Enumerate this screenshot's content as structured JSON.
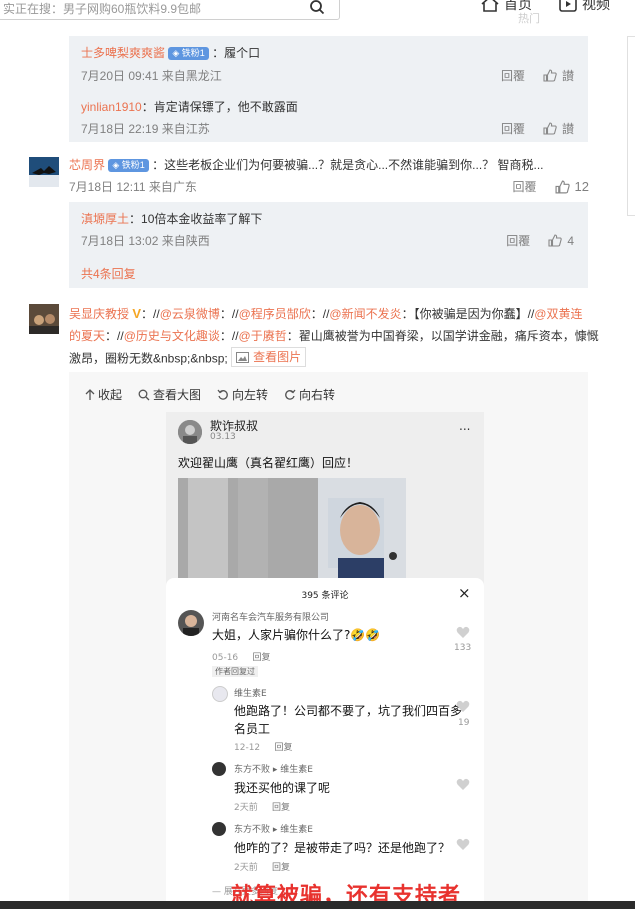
{
  "header": {
    "search_text": "实正在搜：男子网购60瓶饮料9.9包邮",
    "nav_home": "首页",
    "nav_video": "视频",
    "hot_label": "热门"
  },
  "reply_block1": {
    "r1": {
      "user": "士多啤梨爽爽酱",
      "badge": "铁粉1",
      "text": "：履个口",
      "time": "7月20日 09:41 来自黑龙江",
      "reply": "回覆",
      "like": "讃"
    },
    "r2": {
      "user": "yinlian1910",
      "text": "：肯定请保镖了，他不敢露面",
      "time": "7月18日 22:19 来自江苏",
      "reply": "回覆",
      "like": "讃"
    }
  },
  "comment_core": {
    "user": "芯周界",
    "badge": "铁粉1",
    "text": "：这些老板企业们为何要被骗...？就是贪心...不然谁能骗到你...？  智商税...",
    "time": "7月18日 12:11 来自广东",
    "reply": "回覆",
    "likes": "12"
  },
  "reply_block2": {
    "r1": {
      "user": "滇塬厚土",
      "text": "：10倍本金收益率了解下",
      "time": "7月18日 13:02 来自陕西",
      "reply": "回覆",
      "likes": "4"
    },
    "more": "共4条回复"
  },
  "comment_wu": {
    "user": "吴显庆教授",
    "vip": "V",
    "line1_pre": "：//",
    "mention1": "@云泉微博",
    "sep1": "：//",
    "mention2": "@程序员郜欣",
    "sep2": "：//",
    "mention3": "@新闻不发炎",
    "text1": "：【你被骗是因为你蠢】//",
    "mention4": "@双黄连",
    "line2_a": "的夏天",
    "sep3": "：//",
    "mention5": "@历史与文化趣谈",
    "sep4": "：//",
    "mention6": "@于赓哲",
    "text2": "：翟山鹰被誉为中国脊梁，以国学讲金融，痛斥资本，慷慨",
    "line3": "激昂，圈粉无数&nbsp;&nbsp;",
    "view_pic": "查看图片"
  },
  "image_toolbar": {
    "collapse": "收起",
    "view_large": "查看大图",
    "rotate_left": "向左转",
    "rotate_right": "向右转"
  },
  "phone": {
    "author": "欺诈叔叔",
    "date": "03.13",
    "more": "...",
    "post_text": "欢迎翟山鹰（真名翟红鹰）回应！",
    "comments_title": "395 条评论",
    "close": "×",
    "c1": {
      "user": "河南名车会汽车服务有限公司",
      "text": "大姐，人家片骗你什么了?🤣🤣",
      "date": "05-16",
      "reply": "回复",
      "likes": "133",
      "author_tag": "作者回复过"
    },
    "c2": {
      "user": "维生素E",
      "text1": "他跑路了！公司都不要了，坑了我们四百多",
      "text2": "名员工",
      "date": "12-12",
      "reply": "回复",
      "likes": "19"
    },
    "c3": {
      "user": "东方不败",
      "to": "维生素E",
      "text": "我还买他的课了呢",
      "date": "2天前",
      "reply": "回复"
    },
    "c4": {
      "user": "东方不败",
      "to": "维生素E",
      "text": "他咋的了？是被带走了吗？还是他跑了？",
      "date": "2天前",
      "reply": "回复"
    },
    "fold": "展开更多回复",
    "overlay_caption": "就算被骗，还有支持者"
  },
  "colors": {
    "accent_orange": "#eb7350",
    "link_blue": "#3b77c6",
    "reply_bg": "#eef1f4",
    "caption_red": "#e8322e"
  }
}
